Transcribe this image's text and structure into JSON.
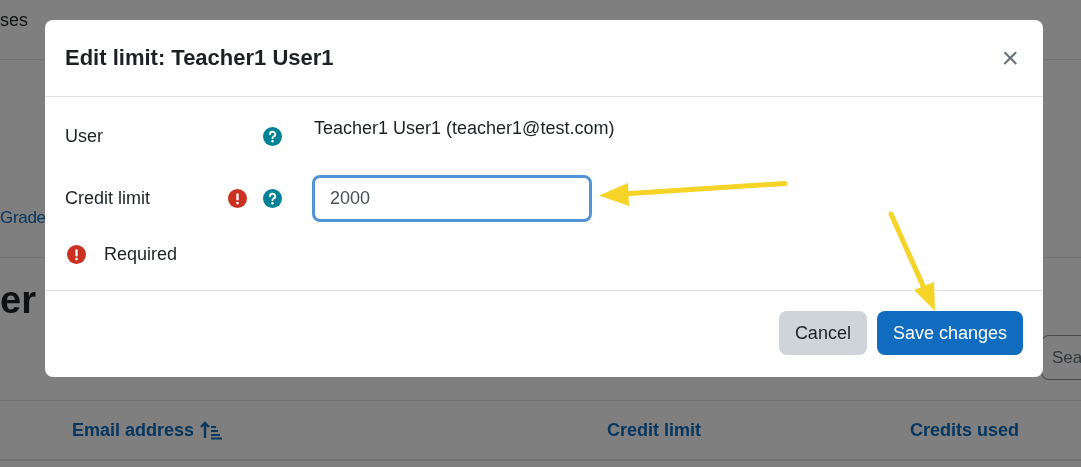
{
  "background": {
    "nav": [
      "ses"
    ],
    "link": "Grade",
    "heading": "er",
    "search": {
      "placeholder": "Sea"
    },
    "table": {
      "columns": [
        {
          "label": "Email address",
          "sorted": true
        },
        {
          "label": "Credit limit",
          "sorted": false
        },
        {
          "label": "Credits used",
          "sorted": false
        }
      ]
    }
  },
  "dialog": {
    "title": "Edit limit: Teacher1 User1",
    "close": "×",
    "fields": [
      {
        "kind": "static",
        "label": "User",
        "error": false,
        "help": true,
        "value": "Teacher1 User1 (teacher1@test.com)"
      },
      {
        "kind": "input",
        "label": "Credit limit",
        "error": true,
        "help": true,
        "value": "2000",
        "focused": true
      }
    ],
    "error_message": "Required",
    "buttons": [
      {
        "kind": "secondary",
        "label": "Cancel"
      },
      {
        "kind": "primary",
        "label": "Save changes"
      }
    ]
  }
}
